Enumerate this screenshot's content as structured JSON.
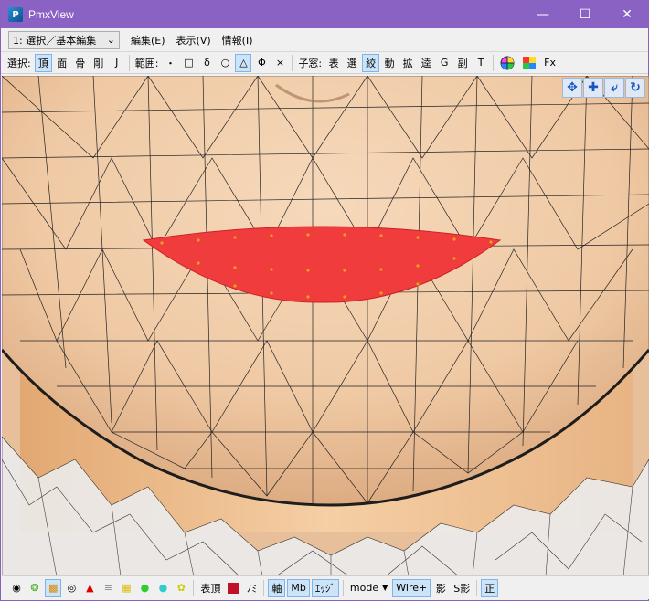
{
  "window": {
    "title": "PmxView"
  },
  "menubar": {
    "mode_select": "1: 選択／基本編集",
    "items": [
      "編集(E)",
      "表示(V)",
      "情報(I)"
    ]
  },
  "toolbar": {
    "select_label": "選択:",
    "select_buttons": [
      "頂",
      "面",
      "骨",
      "剛",
      "J"
    ],
    "range_label": "範囲:",
    "range_buttons": [
      "・",
      "□",
      "δ",
      "○",
      "△",
      "Φ",
      "×"
    ],
    "child_label": "子窓:",
    "child_buttons": [
      "表",
      "選",
      "絞",
      "動",
      "拡",
      "逵",
      "G",
      "副",
      "T"
    ],
    "fx_label": "Fx"
  },
  "statusbar": {
    "show_vertex_label": "表頂",
    "nomi_label": "ﾉﾐ",
    "axis_label": "軸",
    "mb_label": "Mb",
    "edge_label": "ｴｯｼﾞ",
    "mode_label": "mode",
    "wire_label": "Wire+",
    "shadow_label": "影",
    "s_shadow_label": "S影",
    "sei_label": "正"
  },
  "colors": {
    "title_bar": "#8a62c4",
    "selection_red": "#f03c3c",
    "skin": "#e8c4a2"
  }
}
